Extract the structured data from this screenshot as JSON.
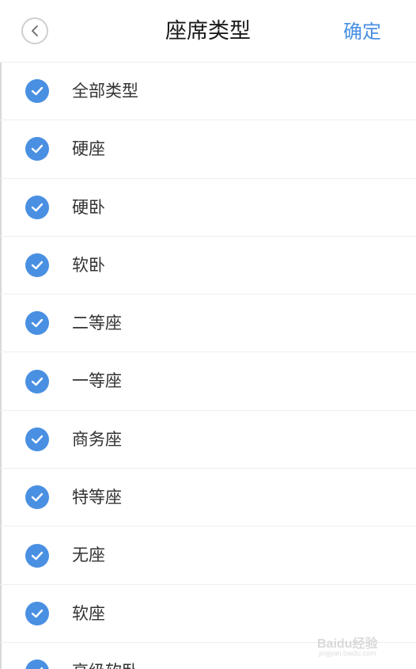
{
  "header": {
    "title": "座席类型",
    "confirm_label": "确定",
    "back_icon": "chevron-left-icon"
  },
  "seat_types": [
    {
      "label": "全部类型",
      "checked": true
    },
    {
      "label": "硬座",
      "checked": true
    },
    {
      "label": "硬卧",
      "checked": true
    },
    {
      "label": "软卧",
      "checked": true
    },
    {
      "label": "二等座",
      "checked": true
    },
    {
      "label": "一等座",
      "checked": true
    },
    {
      "label": "商务座",
      "checked": true
    },
    {
      "label": "特等座",
      "checked": true
    },
    {
      "label": "无座",
      "checked": true
    },
    {
      "label": "软座",
      "checked": true
    },
    {
      "label": "高级软卧",
      "checked": true
    }
  ],
  "watermark": {
    "brand": "Baidu经验",
    "url": "jingyan.baidu.com"
  },
  "colors": {
    "accent": "#4a90e2",
    "text": "#333333",
    "divider": "#efefef"
  }
}
